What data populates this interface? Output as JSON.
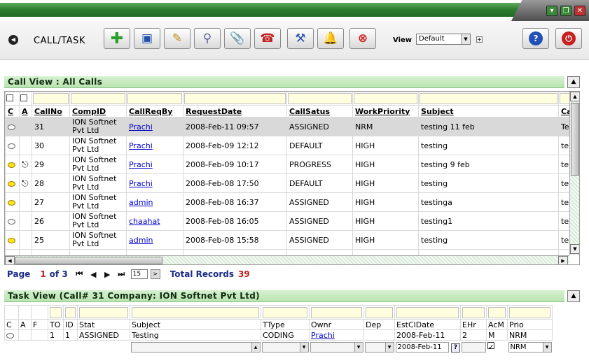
{
  "toolbar": {
    "title": "CALL/TASK",
    "view_label": "View",
    "view_value": "Default"
  },
  "call_view": {
    "header": "Call View : All Calls",
    "columns": [
      "C",
      "A",
      "CallNo",
      "CompID",
      "CallReqBy",
      "RequestDate",
      "CallSatus",
      "WorkPriority",
      "Subject",
      "Ca"
    ],
    "rows": [
      {
        "c_icon": "grey-bubble-icon",
        "a_icon": "",
        "callno": "31",
        "compid": "ION Softnet Pvt Ltd",
        "reqby": "Prachi",
        "date": "2008-Feb-11 09:57",
        "status": "ASSIGNED",
        "priority": "NRM",
        "subject": "testing 11 feb",
        "ca": "Te",
        "selected": true
      },
      {
        "c_icon": "grey-bubble-icon",
        "a_icon": "",
        "callno": "30",
        "compid": "ION Softnet Pvt Ltd",
        "reqby": "Prachi",
        "date": "2008-Feb-09 12:12",
        "status": "DEFAULT",
        "priority": "HIGH",
        "subject": "testing",
        "ca": "te"
      },
      {
        "c_icon": "yellow-bubble-icon",
        "a_icon": "paperclip-icon",
        "callno": "29",
        "compid": "ION Softnet Pvt Ltd",
        "reqby": "Prachi",
        "date": "2008-Feb-09 10:17",
        "status": "PROGRESS",
        "priority": "HIGH",
        "subject": "testing 9 feb",
        "ca": "te"
      },
      {
        "c_icon": "yellow-bubble-icon",
        "a_icon": "paperclip-icon",
        "callno": "28",
        "compid": "ION Softnet Pvt Ltd",
        "reqby": "Prachi",
        "date": "2008-Feb-08 17:50",
        "status": "DEFAULT",
        "priority": "HIGH",
        "subject": "testing",
        "ca": "te"
      },
      {
        "c_icon": "yellow-bubble-icon",
        "a_icon": "",
        "callno": "27",
        "compid": "ION Softnet Pvt Ltd",
        "reqby": "admin",
        "date": "2008-Feb-08 16:37",
        "status": "ASSIGNED",
        "priority": "HIGH",
        "subject": "testinga",
        "ca": "te"
      },
      {
        "c_icon": "grey-bubble-icon",
        "a_icon": "",
        "callno": "26",
        "compid": "ION Softnet Pvt Ltd",
        "reqby": "chaahat",
        "date": "2008-Feb-08 16:05",
        "status": "ASSIGNED",
        "priority": "HIGH",
        "subject": "testing1",
        "ca": "te"
      },
      {
        "c_icon": "yellow-bubble-icon",
        "a_icon": "",
        "callno": "25",
        "compid": "ION Softnet Pvt Ltd",
        "reqby": "admin",
        "date": "2008-Feb-08 15:58",
        "status": "ASSIGNED",
        "priority": "HIGH",
        "subject": "testing",
        "ca": "te"
      },
      {
        "c_icon": "grey-bubble-icon",
        "a_icon": "",
        "callno": "",
        "compid": "ION Softnet",
        "reqby": "",
        "date": "",
        "status": "",
        "priority": "",
        "subject": "",
        "ca": ""
      }
    ]
  },
  "pager": {
    "page_label": "Page",
    "current_page": "1",
    "of_text": "of 3",
    "page_size": "15",
    "total_label": "Total Records",
    "total_value": "39"
  },
  "task_view": {
    "header": "Task View    (Call# 31 Company: ION Softnet Pvt Ltd)",
    "columns": [
      "C",
      "A",
      "F",
      "TO",
      "ID",
      "Stat",
      "Subject",
      "TType",
      "Ownr",
      "Dep",
      "EstClDate",
      "EHr",
      "AcM",
      "Prio"
    ],
    "rows": [
      {
        "to": "1",
        "id": "1",
        "stat": "ASSIGNED",
        "subject": "Testing",
        "ttype": "CODING",
        "ownr": "Prachi",
        "dep": "",
        "estcldate": "2008-Feb-11",
        "ehr": "2",
        "acm": "M",
        "prio": "NRM"
      }
    ],
    "new_row": {
      "estcldate": "2008-Feb-11",
      "prio": "NRM"
    }
  }
}
